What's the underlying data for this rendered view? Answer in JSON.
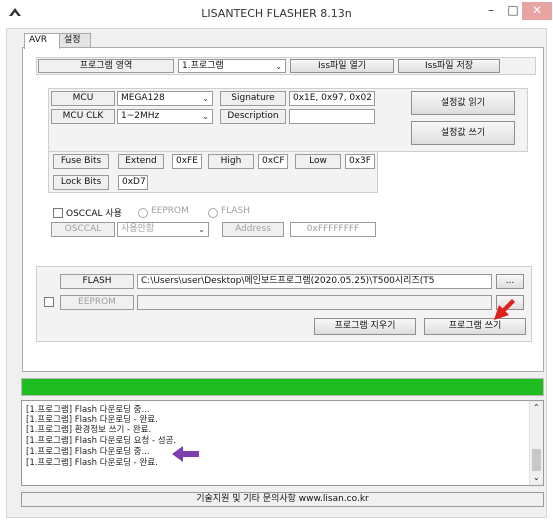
{
  "window": {
    "title": "LISANTECH FLASHER 8.13n",
    "minimize": "–",
    "maximize": "□",
    "close": "✕"
  },
  "tabs": [
    "AVR",
    "설정"
  ],
  "program_area": {
    "label": "프로그램 영역",
    "value": "1.프로그램",
    "iss_open": "Iss파일 열기",
    "iss_save": "Iss파일 저장"
  },
  "mcu": {
    "mcu_label": "MCU",
    "mcu_value": "MEGA128",
    "clk_label": "MCU CLK",
    "clk_value": "1~2MHz",
    "signature_label": "Signature",
    "signature_value": "0x1E, 0x97, 0x02",
    "description_label": "Description",
    "description_value": "",
    "read_settings": "설정값 읽기",
    "write_settings": "설정값 쓰기"
  },
  "fuse": {
    "fuse_label": "Fuse Bits",
    "extend_label": "Extend",
    "extend_value": "0xFE",
    "high_label": "High",
    "high_value": "0xCF",
    "low_label": "Low",
    "low_value": "0x3F",
    "lock_label": "Lock Bits",
    "lock_value": "0xD7"
  },
  "osccal": {
    "checkbox_label": "OSCCAL 사용",
    "eeprom_radio": "EEPROM",
    "flash_radio": "FLASH",
    "osccal_label": "OSCCAL",
    "osccal_value": "사용안함",
    "address_label": "Address",
    "address_value": "0xFFFFFFFF"
  },
  "files": {
    "flash_label": "FLASH",
    "flash_path": "C:\\Users\\user\\Desktop\\메인보드프로그램(2020.05.25)\\T500시리즈(T5",
    "browse": "...",
    "eeprom_label": "EEPROM",
    "eeprom_path": "",
    "erase_button": "프로그램 지우기",
    "write_button": "프로그램 쓰기"
  },
  "progress": {
    "percent": 100,
    "color": "#1fbd1f"
  },
  "log": [
    "[1.프로그램] Flash 다운로딩 중...",
    "[1.프로그램] Flash 다운로딩 - 완료.",
    "[1.프로그램] 환경정보 쓰기 - 완료.",
    "[1.프로그램] Flash 다운로딩 요청 - 성공.",
    "[1.프로그램] Flash 다운로딩 중...",
    "[1.프로그램] Flash 다운로딩 - 완료."
  ],
  "footer": "기술지원 및 기타 문의사항 www.lisan.co.kr",
  "icons": {
    "app": "app-logo-icon",
    "red_arrow": "red-arrow-annotation-icon",
    "purple_arrow": "purple-arrow-annotation-icon"
  },
  "colors": {
    "red_arrow": "#e0201c",
    "purple_arrow": "#7b3fb0"
  }
}
